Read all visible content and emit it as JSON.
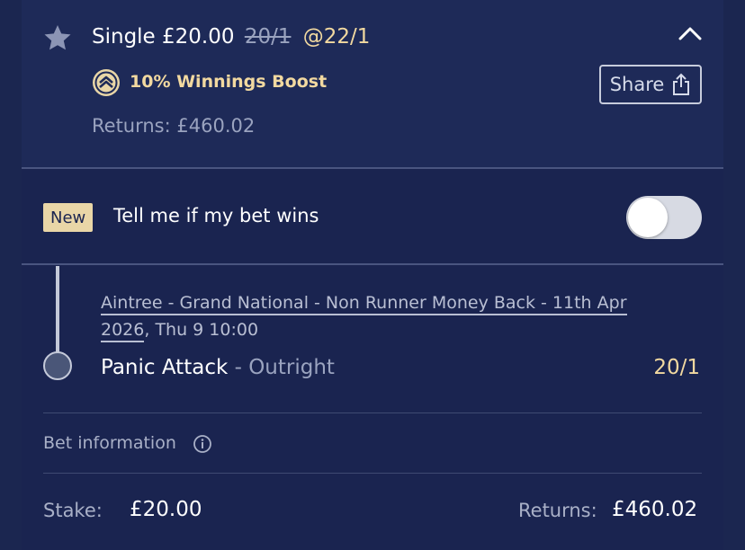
{
  "bet": {
    "type_stake": "Single £20.00",
    "old_odds": "20/1",
    "new_odds": "@22/1",
    "boost_label": "10% Winnings Boost",
    "returns": "Returns: £460.02",
    "share_label": "Share"
  },
  "notify": {
    "badge": "New",
    "label": "Tell me if my bet wins",
    "toggle_on": false
  },
  "event": {
    "line1": "Aintree - Grand National - Non Runner Money Back - 11th Apr",
    "line2_underlined": "2026",
    "line2_rest": ", Thu 9 10:00",
    "selection": "Panic Attack",
    "market": " - Outright",
    "odds": "20/1"
  },
  "bet_info": {
    "label": "Bet information"
  },
  "summary": {
    "stake_label": "Stake:",
    "stake_value": "£20.00",
    "returns_label": "Returns:",
    "returns_value": "£460.02"
  },
  "colors": {
    "background": "#1a2450",
    "header_bg": "#1e2a58",
    "accent_gold": "#f2d9a0",
    "badge_bg": "#e9d6a7"
  },
  "icons": [
    "star-icon",
    "chevron-up-icon",
    "boost-icon",
    "share-icon",
    "info-icon"
  ]
}
